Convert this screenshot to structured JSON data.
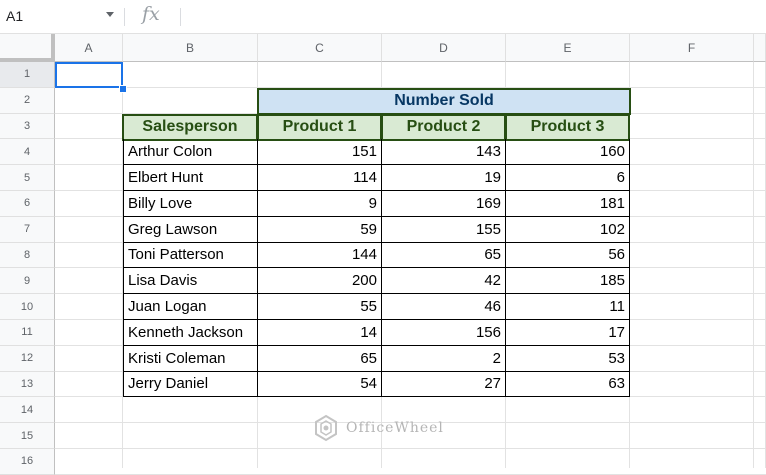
{
  "name_box": "A1",
  "formula_icon": "fx",
  "columns": [
    "A",
    "B",
    "C",
    "D",
    "E",
    "F"
  ],
  "rows": [
    "1",
    "2",
    "3",
    "4",
    "5",
    "6",
    "7",
    "8",
    "9",
    "10",
    "11",
    "12",
    "13",
    "14",
    "15",
    "16"
  ],
  "table": {
    "group_header": "Number Sold",
    "headers": [
      "Salesperson",
      "Product 1",
      "Product 2",
      "Product 3"
    ],
    "data": [
      [
        "Arthur Colon",
        "151",
        "143",
        "160"
      ],
      [
        "Elbert Hunt",
        "114",
        "19",
        "6"
      ],
      [
        "Billy Love",
        "9",
        "169",
        "181"
      ],
      [
        "Greg Lawson",
        "59",
        "155",
        "102"
      ],
      [
        "Toni Patterson",
        "144",
        "65",
        "56"
      ],
      [
        "Lisa Davis",
        "200",
        "42",
        "185"
      ],
      [
        "Juan Logan",
        "55",
        "46",
        "11"
      ],
      [
        "Kenneth Jackson",
        "14",
        "156",
        "17"
      ],
      [
        "Kristi Coleman",
        "65",
        "2",
        "53"
      ],
      [
        "Jerry Daniel",
        "54",
        "27",
        "63"
      ]
    ]
  },
  "watermark": "OfficeWheel",
  "colors": {
    "selection": "#1a73e8",
    "header_blue": "#cfe2f3",
    "header_green": "#d9ead3",
    "border_green": "#274e13"
  }
}
